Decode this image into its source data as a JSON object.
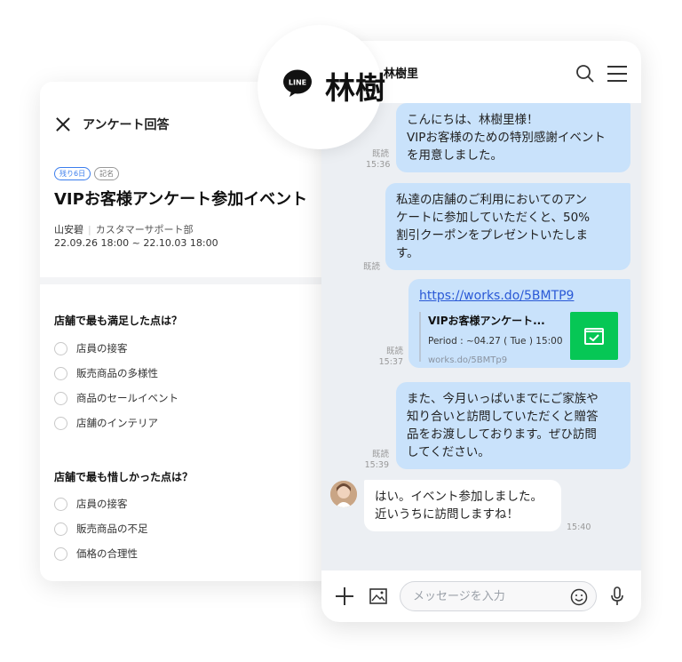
{
  "survey": {
    "header_title": "アンケート回答",
    "badges": [
      "残り6日",
      "記名"
    ],
    "event_title": "VIPお客様アンケート参加イベント",
    "author": "山安碧",
    "department": "カスタマーサポート部",
    "period": "22.09.26 18:00 ~ 22.10.03 18:00",
    "questions": [
      {
        "title": "店舗で最も満足した点は？",
        "options": [
          "店員の接客",
          "販売商品の多様性",
          "商品のセールイベント",
          "店舗のインテリア"
        ]
      },
      {
        "title": "店舗で最も惜しかった点は？",
        "options": [
          "店員の接客",
          "販売商品の不足",
          "価格の合理性"
        ]
      }
    ]
  },
  "chat": {
    "contact_big": "林樹",
    "contact_small": "林樹里",
    "messages": [
      {
        "text": "こんにちは、林樹里様！\nVIPお客様のための特別感謝イベント\nを用意しました。",
        "read": "既読",
        "time": "15:36"
      },
      {
        "text": "私達の店舗のご利用においてのアン\nケートに参加していただくと、50%\n割引クーポンをプレゼントいたしま\nす。",
        "read": "既読",
        "time": ""
      },
      {
        "link": "https://works.do/5BMTP9",
        "preview_title": "VIPお客様アンケート...",
        "preview_period": "Period : ~04.27 ( Tue ) 15:00",
        "preview_url": "works.do/5BMTp9",
        "read": "既読",
        "time": "15:37"
      },
      {
        "text": "また、今月いっぱいまでにご家族や\n知り合いと訪問していただくと贈答\n品をお渡ししております。ぜひ訪問\nしてください。",
        "read": "既読",
        "time": "15:39"
      }
    ],
    "reply": {
      "text": "はい。イベント参加しました。\n近いうちに訪問しますね！",
      "time": "15:40"
    },
    "input_placeholder": "メッセージを入力"
  },
  "colors": {
    "outgoing_bubble": "#c9e2fb",
    "line_green": "#06c755",
    "badge_blue": "#3b7ded"
  }
}
